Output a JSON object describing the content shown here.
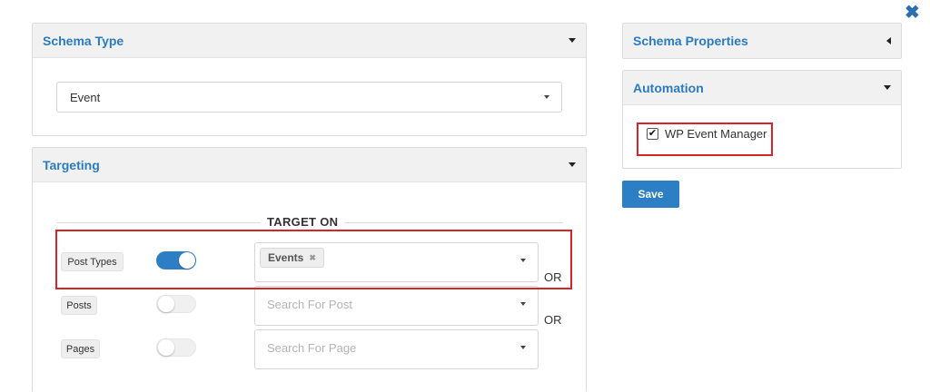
{
  "schema_type": {
    "title": "Schema Type",
    "selected": "Event"
  },
  "targeting": {
    "title": "Targeting",
    "divider_label": "TARGET ON",
    "rows": [
      {
        "label": "Post Types",
        "toggle": "on",
        "selected_chip": "Events",
        "chip_remove": "✖",
        "placeholder": "",
        "connector": "OR"
      },
      {
        "label": "Posts",
        "toggle": "off",
        "placeholder": "Search For Post",
        "connector": "OR"
      },
      {
        "label": "Pages",
        "toggle": "off",
        "placeholder": "Search For Page",
        "connector": ""
      }
    ]
  },
  "schema_properties": {
    "title": "Schema Properties"
  },
  "automation": {
    "title": "Automation",
    "checkbox_label": "WP Event Manager",
    "checked": true
  },
  "save_label": "Save",
  "close_glyph": "✖",
  "colors": {
    "accent": "#2b7bc0",
    "save_button": "#2c7fc4",
    "highlight": "#d9232b",
    "panel_header": "#f1f1f1"
  }
}
